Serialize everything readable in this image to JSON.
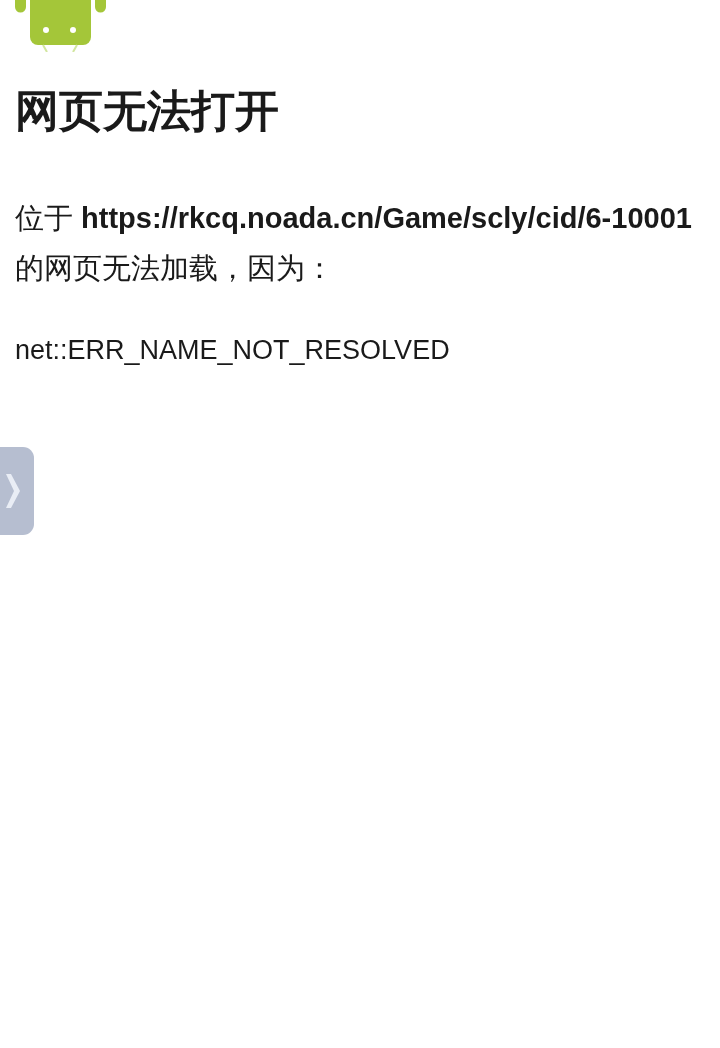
{
  "page": {
    "title": "网页无法打开",
    "message": "位于 **https://rkcq.noada.cn/Game/scly/cid/6-10001** 的网页无法加载，因为：",
    "error_code": "net::ERR_NAME_NOT_RESOLVED"
  }
}
